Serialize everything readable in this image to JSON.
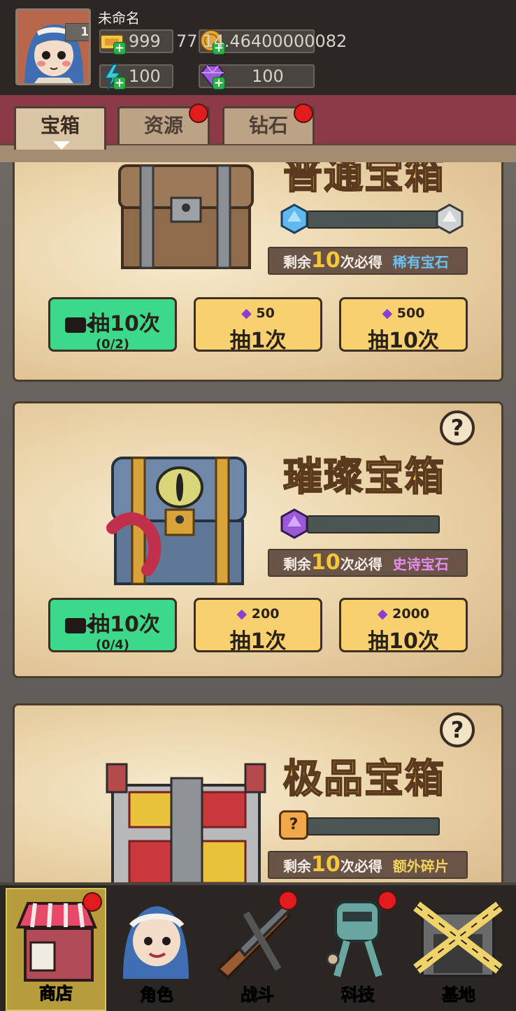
{
  "player": {
    "name": "未命名",
    "level": "1"
  },
  "resources": {
    "tickets": "999",
    "coins": "77 14.46400000082",
    "energy": "100",
    "diamonds": "100"
  },
  "tabs": [
    {
      "label": "宝箱",
      "active": true,
      "badge": false
    },
    {
      "label": "资源",
      "active": false,
      "badge": true
    },
    {
      "label": "钻石",
      "active": false,
      "badge": true
    }
  ],
  "chests": [
    {
      "title": "普通宝箱",
      "remain_prefix": "剩余",
      "remain_count": "10",
      "remain_mid": "次必得",
      "reward": "稀有宝石",
      "reward_color": "#6ec0f0",
      "ad_button": {
        "label": "抽10次",
        "progress": "(0/2)"
      },
      "buy1": {
        "cost": "50",
        "label": "抽1次"
      },
      "buy10": {
        "cost": "500",
        "label": "抽10次"
      }
    },
    {
      "title": "璀璨宝箱",
      "remain_prefix": "剩余",
      "remain_count": "10",
      "remain_mid": "次必得",
      "reward": "史诗宝石",
      "reward_color": "#e98cf0",
      "help": "?",
      "ad_button": {
        "label": "抽10次",
        "progress": "(0/4)"
      },
      "buy1": {
        "cost": "200",
        "label": "抽1次"
      },
      "buy10": {
        "cost": "2000",
        "label": "抽10次"
      }
    },
    {
      "title": "极品宝箱",
      "remain_prefix": "剩余",
      "remain_count": "10",
      "remain_mid": "次必得",
      "reward": "额外碎片",
      "reward_color": "#f4d35a",
      "help": "?",
      "piece_mark": "?"
    }
  ],
  "nav": [
    {
      "label": "商店",
      "active": true,
      "badge": true
    },
    {
      "label": "角色",
      "active": false,
      "badge": false
    },
    {
      "label": "战斗",
      "active": false,
      "badge": true
    },
    {
      "label": "科技",
      "active": false,
      "badge": true
    },
    {
      "label": "基地",
      "active": false,
      "badge": false
    }
  ],
  "colors": {
    "accent_red": "#e01c1c",
    "button_green": "#3dd98a",
    "button_yellow": "#f7d06f",
    "title_gold": "#f0c04a"
  }
}
